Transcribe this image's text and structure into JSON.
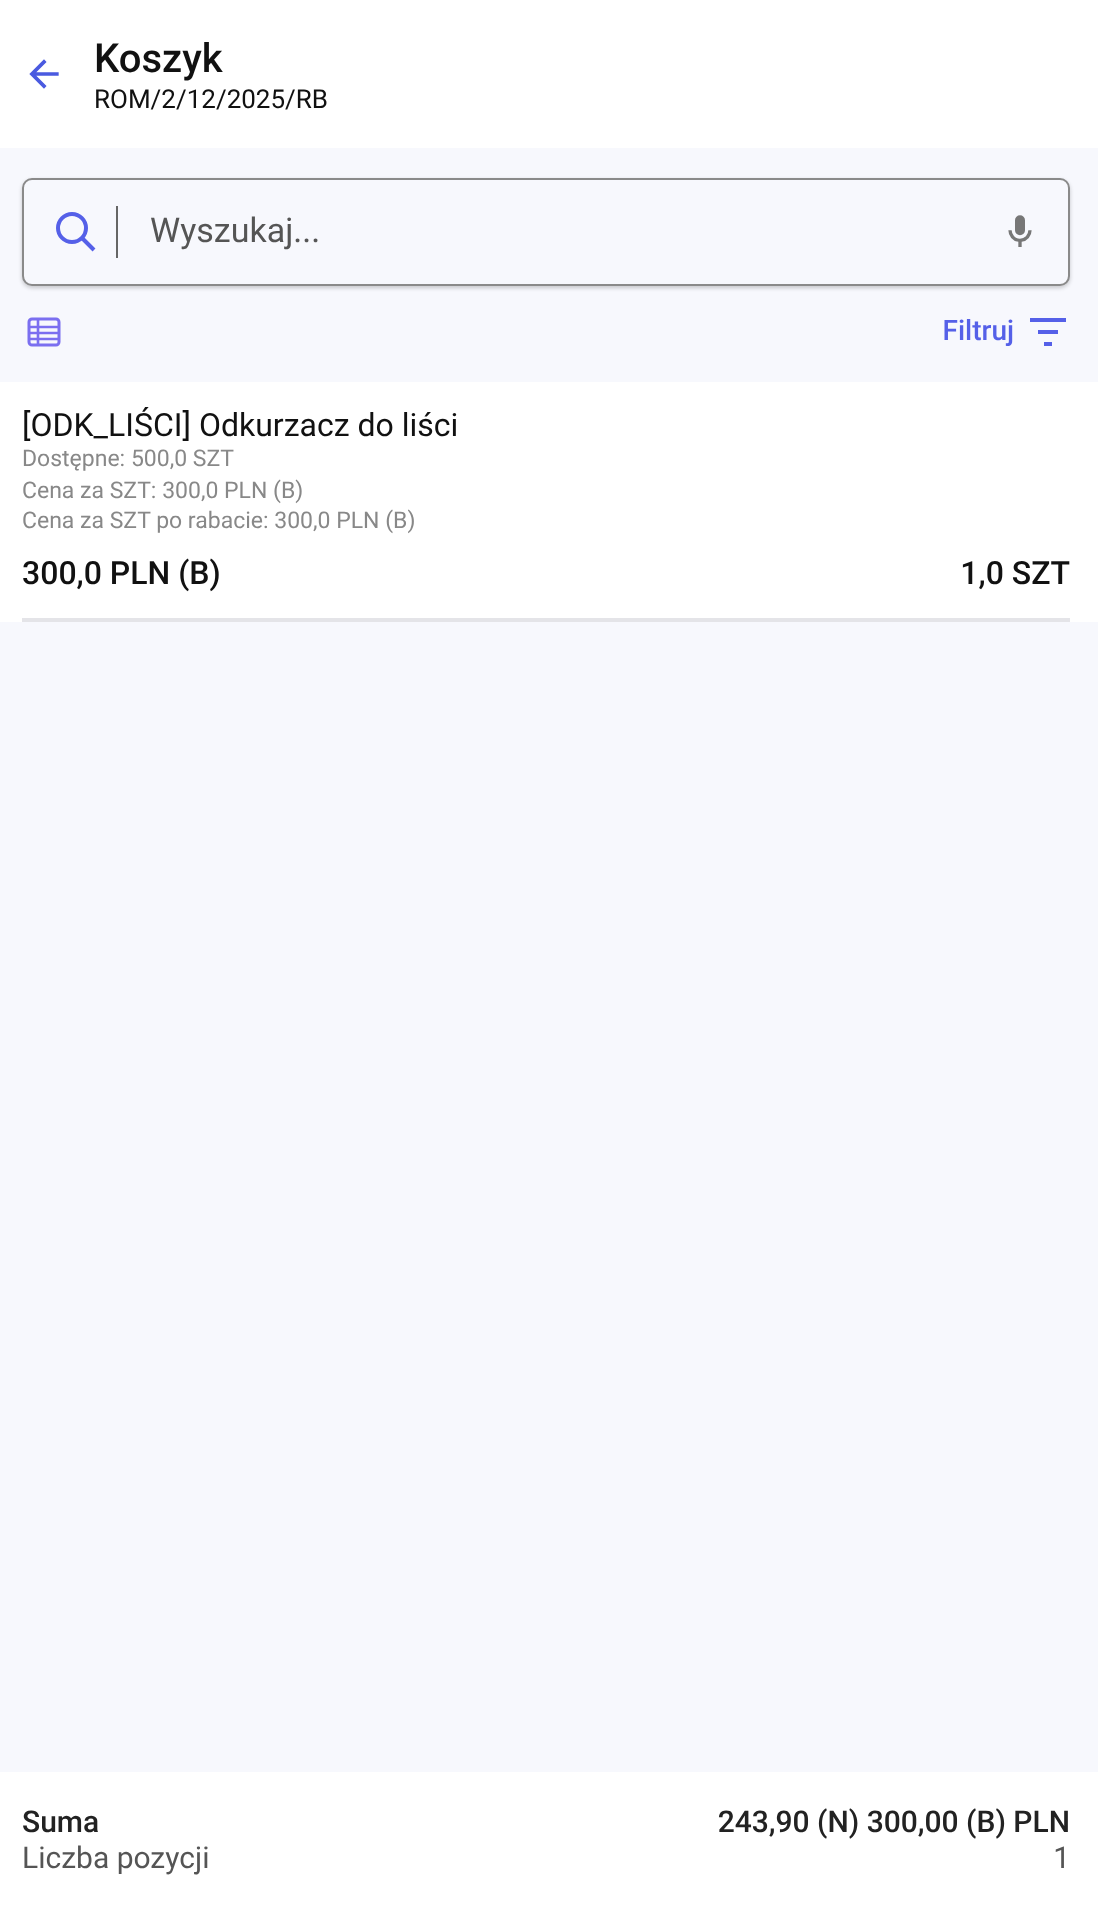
{
  "header": {
    "title": "Koszyk",
    "subtitle": "ROM/2/12/2025/RB"
  },
  "search": {
    "placeholder": "Wyszukaj..."
  },
  "toolbar": {
    "filter_label": "Filtruj"
  },
  "items": [
    {
      "name": "[ODK_LIŚCI] Odkurzacz do liści",
      "details": [
        "Dostępne: 500,0 SZT",
        "Cena za SZT: 300,0 PLN (B)",
        "Cena za SZT po rabacie: 300,0 PLN (B)"
      ],
      "price": "300,0 PLN (B)",
      "quantity": "1,0 SZT"
    }
  ],
  "footer": {
    "rows": [
      {
        "label": "Suma",
        "value": "243,90 (N) 300,00 (B) PLN",
        "kind": "total"
      },
      {
        "label": "Liczba pozycji",
        "value": "1",
        "kind": "count"
      }
    ]
  }
}
